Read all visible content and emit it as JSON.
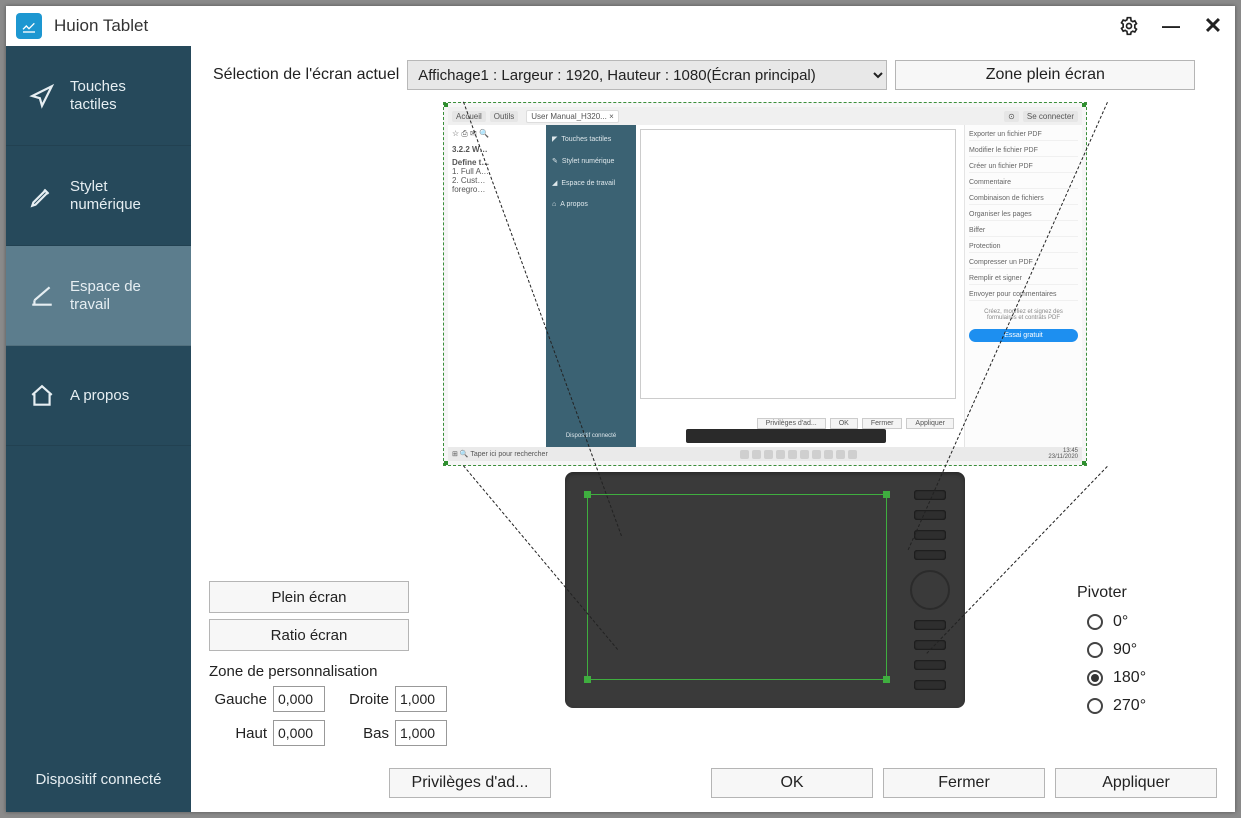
{
  "app": {
    "title": "Huion Tablet"
  },
  "sidebar": {
    "items": [
      {
        "label": "Touches tactiles"
      },
      {
        "label": "Stylet numérique"
      },
      {
        "label": "Espace de travail"
      },
      {
        "label": "A propos"
      }
    ],
    "status": "Dispositif connecté"
  },
  "top": {
    "selection_label": "Sélection de l'écran actuel",
    "selected_display": "Affichage1 : Largeur : 1920, Hauteur : 1080(Écran principal)",
    "full_area_btn": "Zone plein écran"
  },
  "left_controls": {
    "fullscreen_btn": "Plein écran",
    "ratio_btn": "Ratio écran",
    "custom_area_label": "Zone de personnalisation",
    "coords": {
      "left_label": "Gauche",
      "left_value": "0,000",
      "right_label": "Droite",
      "right_value": "1,000",
      "top_label": "Haut",
      "top_value": "0,000",
      "bottom_label": "Bas",
      "bottom_value": "1,000"
    }
  },
  "rotate": {
    "title": "Pivoter",
    "options": [
      "0°",
      "90°",
      "180°",
      "270°"
    ],
    "selected": "180°"
  },
  "footer": {
    "privileges": "Privilèges d'ad...",
    "ok": "OK",
    "close": "Fermer",
    "apply": "Appliquer"
  },
  "inner_preview": {
    "sidebar_items": [
      "Touches tactiles",
      "Stylet numérique",
      "Espace de travail",
      "A propos"
    ],
    "sidebar_status": "Dispositif connecté",
    "tab": "User Manual_H320... ×",
    "doc_lines": [
      "3.2.2 W…",
      "Define t…",
      "1. Full A…",
      "2. Cust…",
      "foregro…"
    ],
    "bottom_buttons": [
      "Privilèges d'ad...",
      "OK",
      "Fermer",
      "Appliquer"
    ],
    "right_panel": [
      "Exporter un fichier PDF",
      "Modifier le fichier PDF",
      "Créer un fichier PDF",
      "Commentaire",
      "Combinaison de fichiers",
      "Organiser les pages",
      "Biffer",
      "Protection",
      "Compresser un PDF",
      "Remplir et signer",
      "Envoyer pour commentaires"
    ],
    "right_note": "Créez, modifiez et signez des formulaires et contrats PDF",
    "right_cta": "Essai gratuit",
    "right_top": "Se connecter",
    "search": "Taper ici pour rechercher",
    "time": "13:45",
    "date": "23/11/2020"
  }
}
